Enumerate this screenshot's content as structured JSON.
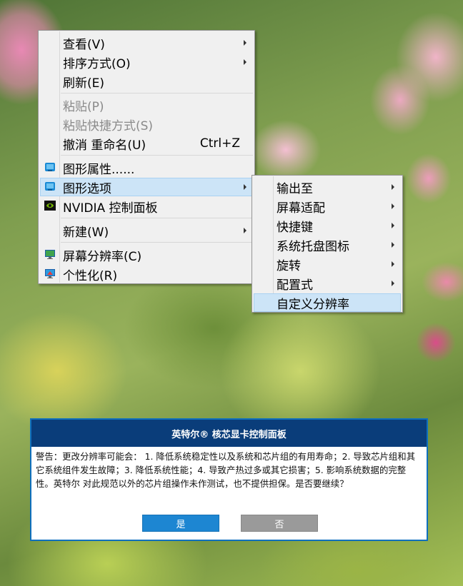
{
  "context_menu": {
    "items": [
      {
        "label": "查看(V)",
        "has_submenu": true,
        "enabled": true
      },
      {
        "label": "排序方式(O)",
        "has_submenu": true,
        "enabled": true
      },
      {
        "label": "刷新(E)",
        "has_submenu": false,
        "enabled": true
      },
      {
        "label": "粘贴(P)",
        "has_submenu": false,
        "enabled": false
      },
      {
        "label": "粘贴快捷方式(S)",
        "has_submenu": false,
        "enabled": false
      },
      {
        "label": "撤消 重命名(U)",
        "shortcut": "Ctrl+Z",
        "has_submenu": false,
        "enabled": true
      },
      {
        "label": "图形属性......",
        "icon": "intel-graphics-icon",
        "enabled": true
      },
      {
        "label": "图形选项",
        "icon": "intel-graphics-icon",
        "has_submenu": true,
        "enabled": true,
        "highlighted": true
      },
      {
        "label": "NVIDIA 控制面板",
        "icon": "nvidia-icon",
        "enabled": true
      },
      {
        "label": "新建(W)",
        "has_submenu": true,
        "enabled": true
      },
      {
        "label": "屏幕分辨率(C)",
        "icon": "display-icon",
        "enabled": true
      },
      {
        "label": "个性化(R)",
        "icon": "personalize-icon",
        "enabled": true
      }
    ]
  },
  "graphics_submenu": {
    "items": [
      {
        "label": "输出至",
        "has_submenu": true
      },
      {
        "label": "屏幕适配",
        "has_submenu": true
      },
      {
        "label": "快捷键",
        "has_submenu": true
      },
      {
        "label": "系统托盘图标",
        "has_submenu": true
      },
      {
        "label": "旋转",
        "has_submenu": true
      },
      {
        "label": "配置式",
        "has_submenu": true
      },
      {
        "label": "自定义分辨率",
        "has_submenu": false,
        "highlighted": true
      }
    ]
  },
  "dialog": {
    "title": "英特尔® 核芯显卡控制面板",
    "message": "警告：更改分辨率可能会： 1. 降低系统稳定性以及系统和芯片组的有用寿命；2. 导致芯片组和其它系统组件发生故障；3. 降低系统性能；4. 导致产热过多或其它损害；5. 影响系统数据的完整性。英特尔 对此规范以外的芯片组操作未作测试，也不提供担保。是否要继续？",
    "yes_label": "是",
    "no_label": "否"
  },
  "colors": {
    "dialog_title_bg": "#0a3d7a",
    "dialog_border": "#0f6fbd",
    "yes_button": "#1d86d2",
    "no_button": "#9a9a9a",
    "menu_highlight": "#cce4f7"
  }
}
